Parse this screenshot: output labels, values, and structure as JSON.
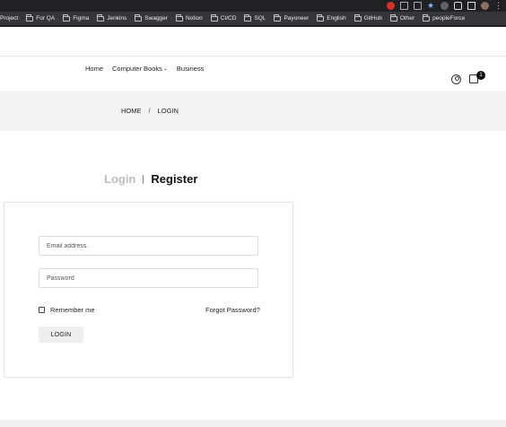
{
  "browser": {
    "bookmarks": [
      "Project",
      "For QA",
      "Figma",
      "Jenkins",
      "Swagger",
      "Notion",
      "CI/CD",
      "SQL",
      "Payoneer",
      "English",
      "GitHub",
      "Other",
      "peopleForce"
    ]
  },
  "nav": {
    "items": [
      {
        "label": "Home"
      },
      {
        "label": "Computer Books"
      },
      {
        "label": "Business"
      }
    ],
    "cart_count": "1"
  },
  "breadcrumb": {
    "home": "HOME",
    "separator": "/",
    "current": "LOGIN"
  },
  "tabs": {
    "login": "Login",
    "register": "Register"
  },
  "form": {
    "email_placeholder": "Email address.",
    "password_placeholder": "Password",
    "remember_label": "Remember me",
    "forgot_label": "Forgot Password?",
    "login_button": "LOGIN"
  }
}
